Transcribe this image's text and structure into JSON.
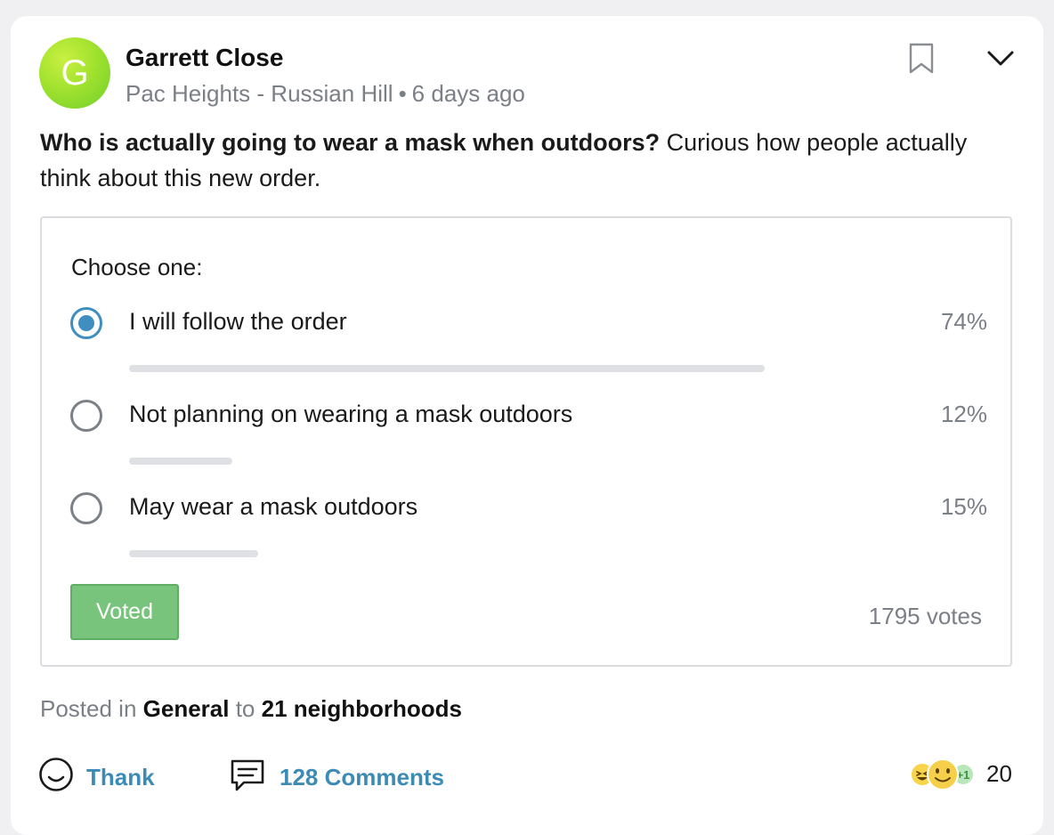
{
  "post": {
    "author": "Garrett Close",
    "avatar_letter": "G",
    "neighborhood": "Pac Heights - Russian Hill",
    "separator": "•",
    "time_ago": "6 days ago",
    "headline": "Who is actually going to wear a mask when outdoors?",
    "body": "Curious how people actually think about this new order."
  },
  "poll": {
    "title": "Choose one:",
    "options": [
      {
        "label": "I will follow the order",
        "percent_text": "74%",
        "percent": 74,
        "selected": true
      },
      {
        "label": "Not planning on wearing a mask outdoors",
        "percent_text": "12%",
        "percent": 12,
        "selected": false
      },
      {
        "label": "May wear a mask outdoors",
        "percent_text": "15%",
        "percent": 15,
        "selected": false
      }
    ],
    "voted_label": "Voted",
    "votes_text": "1795 votes"
  },
  "footer": {
    "posted_in_prefix": "Posted in",
    "category": "General",
    "to_word": "to",
    "audience": "21 neighborhoods"
  },
  "actions": {
    "thank_label": "Thank",
    "comments_label": "128 Comments",
    "reaction_count": "20"
  },
  "icons": {
    "bookmark": "bookmark-icon",
    "menu": "chevron-down-icon",
    "thank": "smiley-icon",
    "comments": "speech-bubble-icon"
  },
  "colors": {
    "accent": "#3e8fc0",
    "link": "#3b8bb5",
    "voted": "#79c47c",
    "avatar": "#a2e22f"
  }
}
